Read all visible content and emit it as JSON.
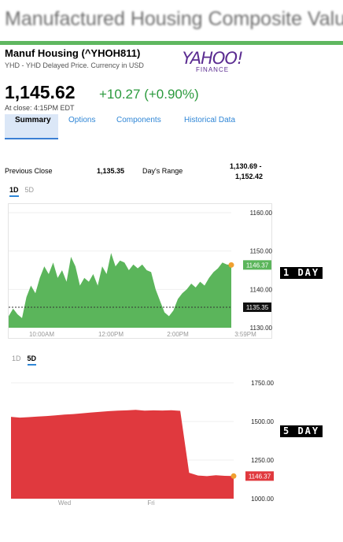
{
  "banner": {
    "title": "Manufactured Housing Composite Value"
  },
  "stock": {
    "name": "Manuf Housing (^YHOH811)",
    "subtitle": "YHD - YHD Delayed Price. Currency in USD",
    "price": "1,145.62",
    "change": "+10.27 (+0.90%)",
    "close_time": "At close: 4:15PM EDT"
  },
  "logo": {
    "main": "YAHOO!",
    "sub": "FINANCE"
  },
  "tabs": [
    {
      "label": "Summary"
    },
    {
      "label": "Options"
    },
    {
      "label": "Components"
    },
    {
      "label": "Historical Data"
    }
  ],
  "stats": {
    "prev_close_label": "Previous Close",
    "prev_close_value": "1,135.35",
    "days_range_label": "Day's Range",
    "days_range_line1": "1,130.69 -",
    "days_range_line2": "1,152.42"
  },
  "toggle1": {
    "a": "1D",
    "b": "5D",
    "selected": "1D"
  },
  "toggle2": {
    "a": "1D",
    "b": "5D",
    "selected": "5D"
  },
  "stamps": {
    "one_day": "1 DAY",
    "five_day": "5 DAY"
  },
  "colors": {
    "up": "#5bb55b",
    "down": "#e0393e",
    "current_dot": "#f0a030",
    "link": "#2f86d6"
  },
  "chart_data": [
    {
      "type": "area",
      "range": "1D",
      "x_ticks": [
        "10:00AM",
        "12:00PM",
        "2:00PM",
        "3:59PM"
      ],
      "y_ticks": [
        "1160.00",
        "1150.00",
        "1140.00",
        "1130.00"
      ],
      "ylim": [
        1130,
        1160
      ],
      "previous_close_line": 1135.35,
      "previous_close_label": "1135.35",
      "current_value": 1146.37,
      "current_label": "1146.37",
      "values": [
        1133,
        1135,
        1133.5,
        1132.5,
        1138,
        1141,
        1139,
        1143,
        1146,
        1144,
        1147,
        1143,
        1145,
        1142,
        1148.5,
        1146,
        1141,
        1143,
        1142,
        1144,
        1141,
        1146,
        1144,
        1149.5,
        1146,
        1147.5,
        1147,
        1145,
        1146.5,
        1145.5,
        1146.5,
        1145,
        1144.5,
        1140,
        1137,
        1134,
        1133,
        1134.5,
        1137.5,
        1139,
        1140,
        1141.5,
        1140.5,
        1142,
        1141,
        1143,
        1144.5,
        1145.5,
        1147,
        1146.5,
        1146.37
      ]
    },
    {
      "type": "area",
      "range": "5D",
      "x_ticks": [
        "Wed",
        "Fri"
      ],
      "y_ticks": [
        "1750.00",
        "1500.00",
        "1250.00",
        "1000.00"
      ],
      "ylim": [
        1000,
        1750
      ],
      "current_value": 1146.37,
      "current_label": "1146.37",
      "values": [
        1530,
        1525,
        1528,
        1532,
        1535,
        1540,
        1545,
        1548,
        1553,
        1558,
        1562,
        1567,
        1570,
        1572,
        1575,
        1570,
        1572,
        1571,
        1573,
        1569,
        1168,
        1150,
        1146,
        1152,
        1148,
        1146.37
      ]
    }
  ]
}
